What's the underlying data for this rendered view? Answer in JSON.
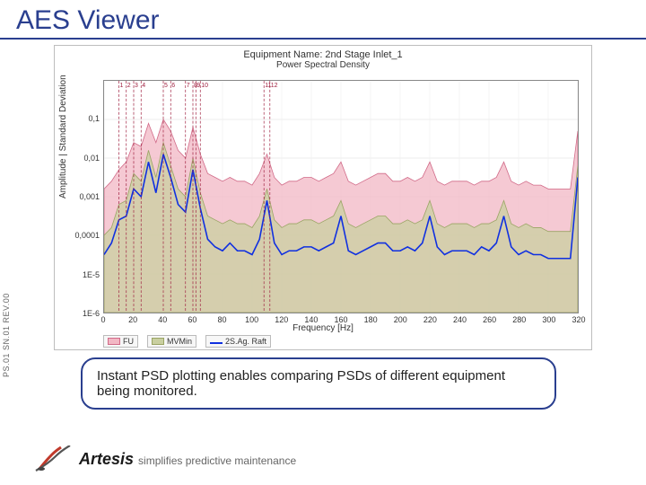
{
  "title": "AES Viewer",
  "callout": "Instant PSD plotting enables comparing PSDs of different equipment being monitored.",
  "side_code": "PS.01 SN.01 REV.00",
  "brand": {
    "name": "Artesis",
    "tagline": "simplifies predictive maintenance"
  },
  "chart_data": {
    "type": "line",
    "title": "Equipment Name: 2nd Stage Inlet_1",
    "subtitle": "Power Spectral Density",
    "xlabel": "Frequency [Hz]",
    "ylabel": "Amplitude | Standard Deviation",
    "xlim": [
      0,
      320
    ],
    "ylim_log10": [
      -6,
      0
    ],
    "yticks_tex": [
      "0,1",
      "0,01",
      "0,001",
      "0,0001",
      "1E-5",
      "1E-6"
    ],
    "yticks_log10": [
      -1,
      -2,
      -3,
      -4,
      -5,
      -6
    ],
    "xticks": [
      0,
      20,
      40,
      60,
      80,
      100,
      120,
      140,
      160,
      180,
      200,
      220,
      240,
      260,
      280,
      300,
      320
    ],
    "markers": [
      {
        "label": "1",
        "hz": 10
      },
      {
        "label": "2",
        "hz": 15
      },
      {
        "label": "3",
        "hz": 20
      },
      {
        "label": "4",
        "hz": 25
      },
      {
        "label": "5",
        "hz": 40
      },
      {
        "label": "6",
        "hz": 45
      },
      {
        "label": "7",
        "hz": 55
      },
      {
        "label": "8",
        "hz": 60
      },
      {
        "label": "9",
        "hz": 62
      },
      {
        "label": "10",
        "hz": 65
      },
      {
        "label": "11",
        "hz": 108
      },
      {
        "label": "12",
        "hz": 112
      }
    ],
    "series": [
      {
        "name": "FU",
        "style": "area-pink",
        "x": [
          0,
          5,
          10,
          15,
          20,
          25,
          30,
          35,
          40,
          45,
          50,
          55,
          60,
          65,
          70,
          75,
          80,
          85,
          90,
          95,
          100,
          105,
          110,
          115,
          120,
          125,
          130,
          135,
          140,
          145,
          150,
          155,
          160,
          165,
          170,
          175,
          180,
          185,
          190,
          195,
          200,
          205,
          210,
          215,
          220,
          225,
          230,
          235,
          240,
          245,
          250,
          255,
          260,
          265,
          270,
          275,
          280,
          285,
          290,
          295,
          300,
          305,
          310,
          315,
          320
        ],
        "y_log10": [
          -2.8,
          -2.6,
          -2.3,
          -2.1,
          -1.6,
          -1.7,
          -1.1,
          -1.6,
          -1.0,
          -1.3,
          -1.8,
          -2.0,
          -1.2,
          -1.9,
          -2.4,
          -2.5,
          -2.6,
          -2.5,
          -2.6,
          -2.6,
          -2.7,
          -2.4,
          -1.9,
          -2.5,
          -2.7,
          -2.6,
          -2.6,
          -2.5,
          -2.5,
          -2.6,
          -2.5,
          -2.4,
          -2.1,
          -2.6,
          -2.7,
          -2.6,
          -2.5,
          -2.4,
          -2.4,
          -2.6,
          -2.6,
          -2.5,
          -2.6,
          -2.5,
          -2.1,
          -2.6,
          -2.7,
          -2.6,
          -2.6,
          -2.6,
          -2.7,
          -2.6,
          -2.6,
          -2.5,
          -2.1,
          -2.6,
          -2.7,
          -2.6,
          -2.7,
          -2.7,
          -2.8,
          -2.8,
          -2.8,
          -2.8,
          -1.3
        ]
      },
      {
        "name": "MVMin",
        "style": "area-olive",
        "x": [
          0,
          5,
          10,
          15,
          20,
          25,
          30,
          35,
          40,
          45,
          50,
          55,
          60,
          65,
          70,
          75,
          80,
          85,
          90,
          95,
          100,
          105,
          110,
          115,
          120,
          125,
          130,
          135,
          140,
          145,
          150,
          155,
          160,
          165,
          170,
          175,
          180,
          185,
          190,
          195,
          200,
          205,
          210,
          215,
          220,
          225,
          230,
          235,
          240,
          245,
          250,
          255,
          260,
          265,
          270,
          275,
          280,
          285,
          290,
          295,
          300,
          305,
          310,
          315,
          320
        ],
        "y_log10": [
          -4.0,
          -3.8,
          -3.2,
          -3.1,
          -2.4,
          -2.6,
          -1.8,
          -2.5,
          -1.6,
          -2.2,
          -2.8,
          -3.0,
          -2.0,
          -2.9,
          -3.5,
          -3.6,
          -3.7,
          -3.6,
          -3.7,
          -3.7,
          -3.8,
          -3.5,
          -2.8,
          -3.6,
          -3.8,
          -3.7,
          -3.7,
          -3.6,
          -3.6,
          -3.7,
          -3.6,
          -3.5,
          -3.1,
          -3.7,
          -3.8,
          -3.7,
          -3.6,
          -3.5,
          -3.5,
          -3.7,
          -3.7,
          -3.6,
          -3.7,
          -3.6,
          -3.1,
          -3.7,
          -3.8,
          -3.7,
          -3.7,
          -3.7,
          -3.8,
          -3.7,
          -3.7,
          -3.6,
          -3.1,
          -3.7,
          -3.8,
          -3.7,
          -3.8,
          -3.8,
          -3.9,
          -3.9,
          -3.9,
          -3.9,
          -2.2
        ]
      },
      {
        "name": "2S.Ag. Raft",
        "style": "line-blue",
        "x": [
          0,
          5,
          10,
          15,
          20,
          25,
          30,
          35,
          40,
          45,
          50,
          55,
          60,
          65,
          70,
          75,
          80,
          85,
          90,
          95,
          100,
          105,
          110,
          115,
          120,
          125,
          130,
          135,
          140,
          145,
          150,
          155,
          160,
          165,
          170,
          175,
          180,
          185,
          190,
          195,
          200,
          205,
          210,
          215,
          220,
          225,
          230,
          235,
          240,
          245,
          250,
          255,
          260,
          265,
          270,
          275,
          280,
          285,
          290,
          295,
          300,
          305,
          310,
          315,
          320
        ],
        "y_log10": [
          -4.5,
          -4.2,
          -3.6,
          -3.5,
          -2.8,
          -3.0,
          -2.1,
          -2.9,
          -1.9,
          -2.5,
          -3.2,
          -3.4,
          -2.3,
          -3.3,
          -4.1,
          -4.3,
          -4.4,
          -4.2,
          -4.4,
          -4.4,
          -4.5,
          -4.1,
          -3.1,
          -4.2,
          -4.5,
          -4.4,
          -4.4,
          -4.3,
          -4.3,
          -4.4,
          -4.3,
          -4.2,
          -3.5,
          -4.4,
          -4.5,
          -4.4,
          -4.3,
          -4.2,
          -4.2,
          -4.4,
          -4.4,
          -4.3,
          -4.4,
          -4.2,
          -3.5,
          -4.3,
          -4.5,
          -4.4,
          -4.4,
          -4.4,
          -4.5,
          -4.3,
          -4.4,
          -4.2,
          -3.5,
          -4.3,
          -4.5,
          -4.4,
          -4.5,
          -4.5,
          -4.6,
          -4.6,
          -4.6,
          -4.6,
          -2.5
        ]
      }
    ],
    "colors": {
      "pink": "#f2b7c4",
      "pink_line": "#d16a88",
      "olive": "#c9cfa0",
      "olive_line": "#9aa464",
      "blue": "#1030e0",
      "marker": "#a02040"
    }
  }
}
